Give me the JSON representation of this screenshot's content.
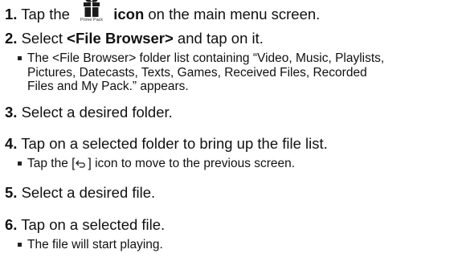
{
  "steps": [
    {
      "number": "1.",
      "before": "Tap the",
      "icon_name": "prime-pack-icon",
      "icon_caption": "Prime Pack",
      "bold": "icon",
      "after": " on the main menu screen."
    },
    {
      "number": "2.",
      "before": "Select ",
      "bold": "<File Browser>",
      "after": " and tap on it.",
      "note": "The <File Browser> folder list containing “Video, Music, Playlists,\nPictures, Datecasts, Texts, Games, Received Files, Recorded\nFiles and My Pack.” appears."
    },
    {
      "number": "3.",
      "text": "Select a desired folder."
    },
    {
      "number": "4.",
      "text": "Tap on a selected folder to bring up the file list.",
      "note_before": "Tap the [",
      "note_icon": "back-arrow-icon",
      "note_after": "] icon to move to the previous screen."
    },
    {
      "number": "5.",
      "text": "Select a desired file."
    },
    {
      "number": "6.",
      "text": "Tap on a selected file.",
      "note": "The file will start playing."
    }
  ]
}
